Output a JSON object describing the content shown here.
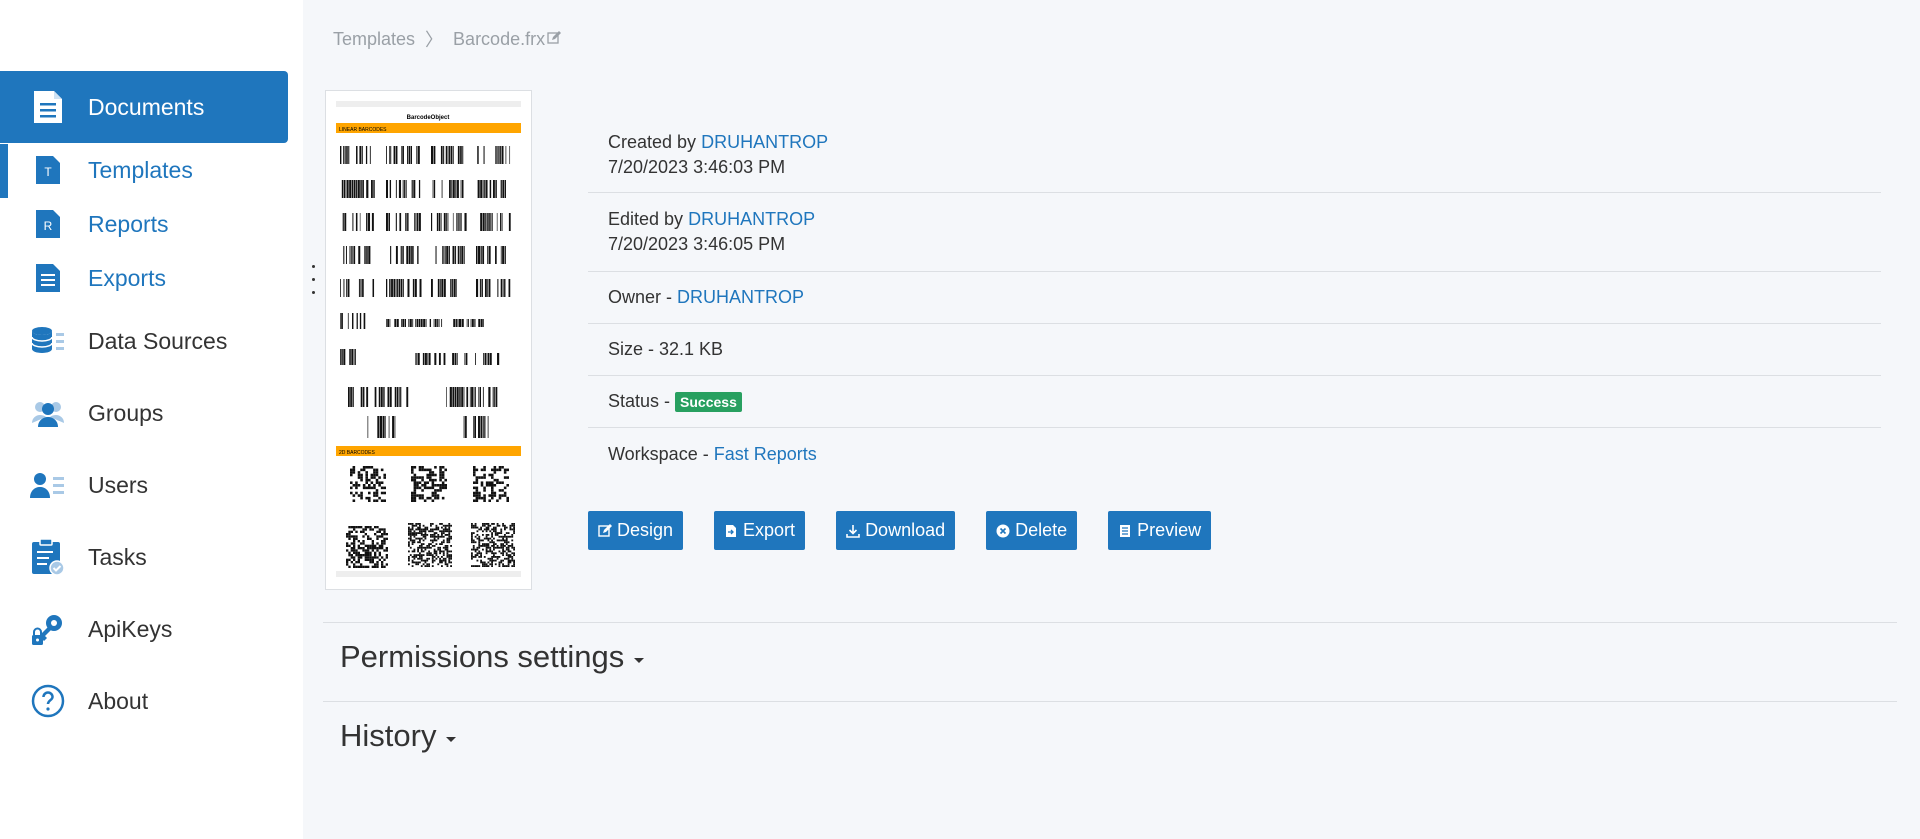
{
  "sidebar": {
    "items": [
      {
        "label": "Documents",
        "icon": "document-icon"
      },
      {
        "label": "Templates",
        "icon": "template-icon",
        "letter": "T"
      },
      {
        "label": "Reports",
        "icon": "report-icon",
        "letter": "R"
      },
      {
        "label": "Exports",
        "icon": "export-list-icon"
      },
      {
        "label": "Data Sources",
        "icon": "database-icon"
      },
      {
        "label": "Groups",
        "icon": "groups-icon"
      },
      {
        "label": "Users",
        "icon": "users-icon"
      },
      {
        "label": "Tasks",
        "icon": "tasks-icon"
      },
      {
        "label": "ApiKeys",
        "icon": "key-icon"
      },
      {
        "label": "About",
        "icon": "help-icon"
      }
    ]
  },
  "breadcrumb": {
    "root": "Templates",
    "current": "Barcode.frx"
  },
  "details": {
    "created_prefix": "Created by",
    "created_by": "DRUHANTROP",
    "created_at": "7/20/2023 3:46:03 PM",
    "edited_prefix": "Edited by",
    "edited_by": "DRUHANTROP",
    "edited_at": "7/20/2023 3:46:05 PM",
    "owner_prefix": "Owner -",
    "owner": "DRUHANTROP",
    "size_text": "Size - 32.1 KB",
    "status_prefix": "Status -",
    "status": "Success",
    "workspace_prefix": "Workspace -",
    "workspace": "Fast Reports"
  },
  "actions": {
    "design": "Design",
    "export": "Export",
    "download": "Download",
    "delete": "Delete",
    "preview": "Preview"
  },
  "sections": {
    "permissions": "Permissions settings",
    "history": "History"
  },
  "thumbnail": {
    "title": "BarcodeObject",
    "linear_header": "LINEAR BARCODES",
    "twod_header": "2D BARCODES"
  },
  "colors": {
    "accent": "#1f76bd",
    "success": "#28a060",
    "thumb_header": "#ffa500"
  }
}
